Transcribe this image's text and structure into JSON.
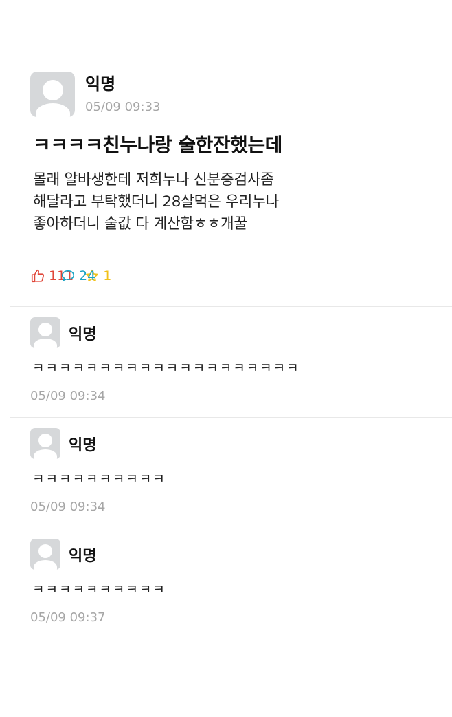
{
  "post": {
    "author": "익명",
    "time": "05/09 09:33",
    "title": "ㅋㅋㅋㅋ친누나랑 술한잔했는데",
    "body_lines": [
      "몰래 알바생한테 저희누나 신분증검사좀",
      "해달라고 부탁했더니 28살먹은 우리누나",
      "좋아하더니 술값 다 계산함ㅎㅎ개꿀"
    ],
    "stats": {
      "likes": "111",
      "comments": "24",
      "scraps": "1",
      "like_icon": "thumbs-up-icon",
      "comment_icon": "speech-bubble-icon",
      "scrap_icon": "star-icon",
      "like_color": "#e0473a",
      "comment_color": "#1aa3c4",
      "scrap_color": "#f1c11a"
    }
  },
  "comments": [
    {
      "author": "익명",
      "text": "ㅋㅋㅋㅋㅋㅋㅋㅋㅋㅋㅋㅋㅋㅋㅋㅋㅋㅋㅋㅋ",
      "time": "05/09 09:34"
    },
    {
      "author": "익명",
      "text": "ㅋㅋㅋㅋㅋㅋㅋㅋㅋㅋ",
      "time": "05/09 09:34"
    },
    {
      "author": "익명",
      "text": "ㅋㅋㅋㅋㅋㅋㅋㅋㅋㅋ",
      "time": "05/09 09:37"
    }
  ]
}
